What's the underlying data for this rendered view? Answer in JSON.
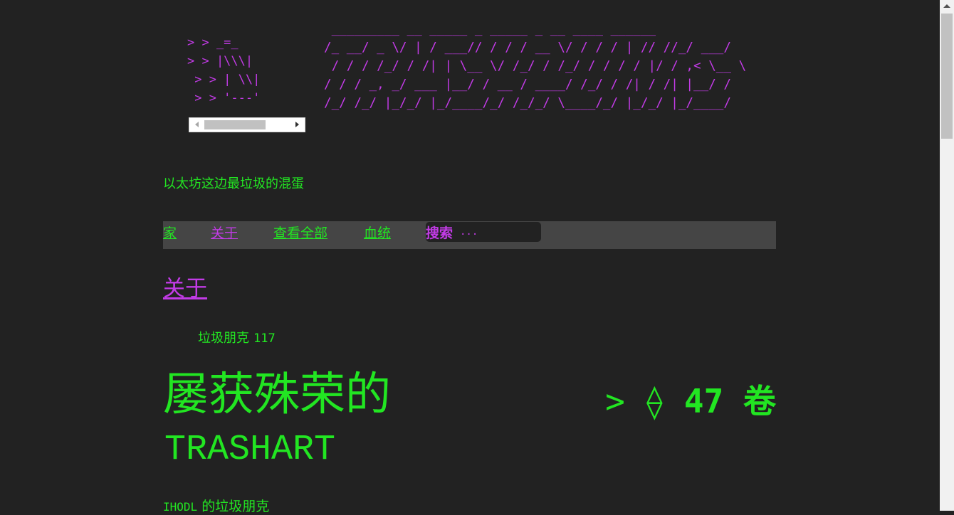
{
  "logo": {
    "ascii_left": "> > _=_\n> > |\\\\\\|\n > > | \\\\|\n > > '---'",
    "ascii_right": " _________ __ _____ _ _____ _ __ ____ ______\n/_ __/ _ \\/ | / ___// / / / __ \\/ / / / | // //_/ ___/\n / / / /_/ / /| | \\__ \\/ /_/ / /_/ / / / / |/ / ,< \\__ \\\n/ / / _, _/ ___ |__/ / __ / ____/ /_/ / /| / /| |__/ /\n/_/ /_/ |_/_/ |_/____/_/ /_/_/ \\____/_/ |_/_/ |_/____/"
  },
  "tagline": "以太坊这边最垃圾的混蛋",
  "nav": {
    "items": [
      "家",
      "关于",
      "查看全部",
      "血统"
    ],
    "search_label": "搜索",
    "search_placeholder": "..."
  },
  "section_title": "关于",
  "item": {
    "sub_label": "垃圾朋克",
    "sub_number": "117",
    "title": "屡获殊荣的",
    "name": "TRASHART",
    "price_prefix": ">",
    "price_symbol": "⟠",
    "price_value": "47",
    "price_unit": "卷",
    "owner_handle": "IHODL",
    "owner_suffix": "的垃圾朋克"
  },
  "colors": {
    "background": "#222222",
    "accent_green": "#22e622",
    "accent_purple": "#c23be6",
    "nav_bg": "#454545"
  }
}
